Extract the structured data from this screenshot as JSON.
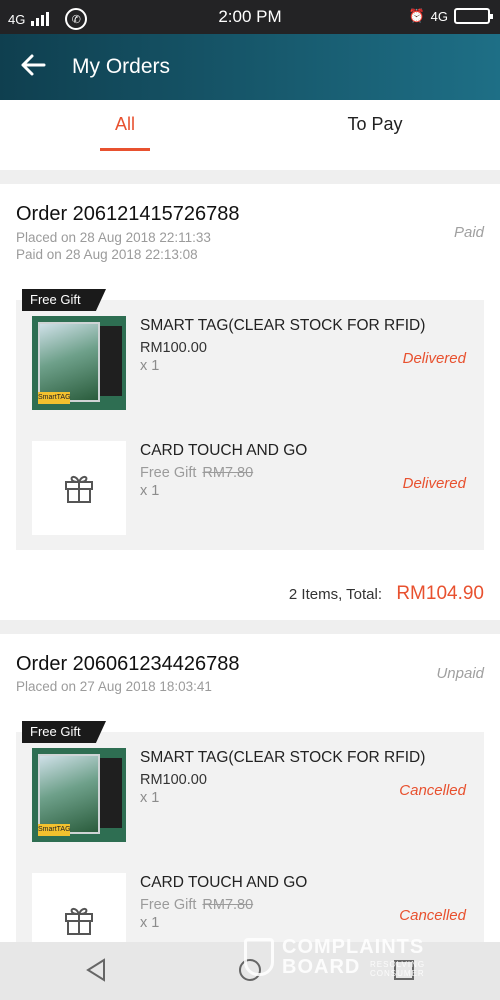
{
  "status_bar": {
    "network_left": "4G",
    "time": "2:00 PM",
    "network_right": "4G"
  },
  "app_bar": {
    "title": "My Orders"
  },
  "tabs": [
    {
      "label": "All",
      "active": true
    },
    {
      "label": "To Pay",
      "active": false
    }
  ],
  "orders": [
    {
      "order_no": "Order 206121415726788",
      "placed": "Placed on 28 Aug 2018  22:11:33",
      "paid": "Paid on 28 Aug 2018  22:13:08",
      "status": "Paid",
      "gift_tag": "Free Gift",
      "items": [
        {
          "name": "SMART TAG(CLEAR STOCK FOR RFID)",
          "price": "RM100.00",
          "qty": "x 1",
          "status": "Delivered",
          "thumb_label": "SmartTAG"
        },
        {
          "name": "CARD TOUCH AND GO",
          "price": "Free Gift",
          "original_price": "RM7.80",
          "qty": "x 1",
          "status": "Delivered"
        }
      ],
      "total_label": "2 Items, Total:",
      "total_value": "RM104.90"
    },
    {
      "order_no": "Order 206061234426788",
      "placed": "Placed on 27 Aug 2018  18:03:41",
      "status": "Unpaid",
      "gift_tag": "Free Gift",
      "items": [
        {
          "name": "SMART TAG(CLEAR STOCK FOR RFID)",
          "price": "RM100.00",
          "qty": "x 1",
          "status": "Cancelled",
          "thumb_label": "SmartTAG"
        },
        {
          "name": "CARD TOUCH AND GO",
          "price": "Free Gift",
          "original_price": "RM7.80",
          "qty": "x 1",
          "status": "Cancelled"
        }
      ]
    }
  ],
  "watermark": {
    "line1": "COMPLAINTS",
    "line2": "BOARD",
    "tagline": "RESOLVING\nCONSUMER"
  },
  "colors": {
    "accent": "#e8512f",
    "app_bar_start": "#0f3f4f",
    "app_bar_end": "#1e6f86",
    "status_bar": "#232325"
  },
  "icons": {
    "back": "arrow-left-icon",
    "gift": "gift-icon",
    "nav_back": "triangle-back-icon",
    "nav_home": "circle-home-icon",
    "nav_recent": "square-recent-icon"
  }
}
